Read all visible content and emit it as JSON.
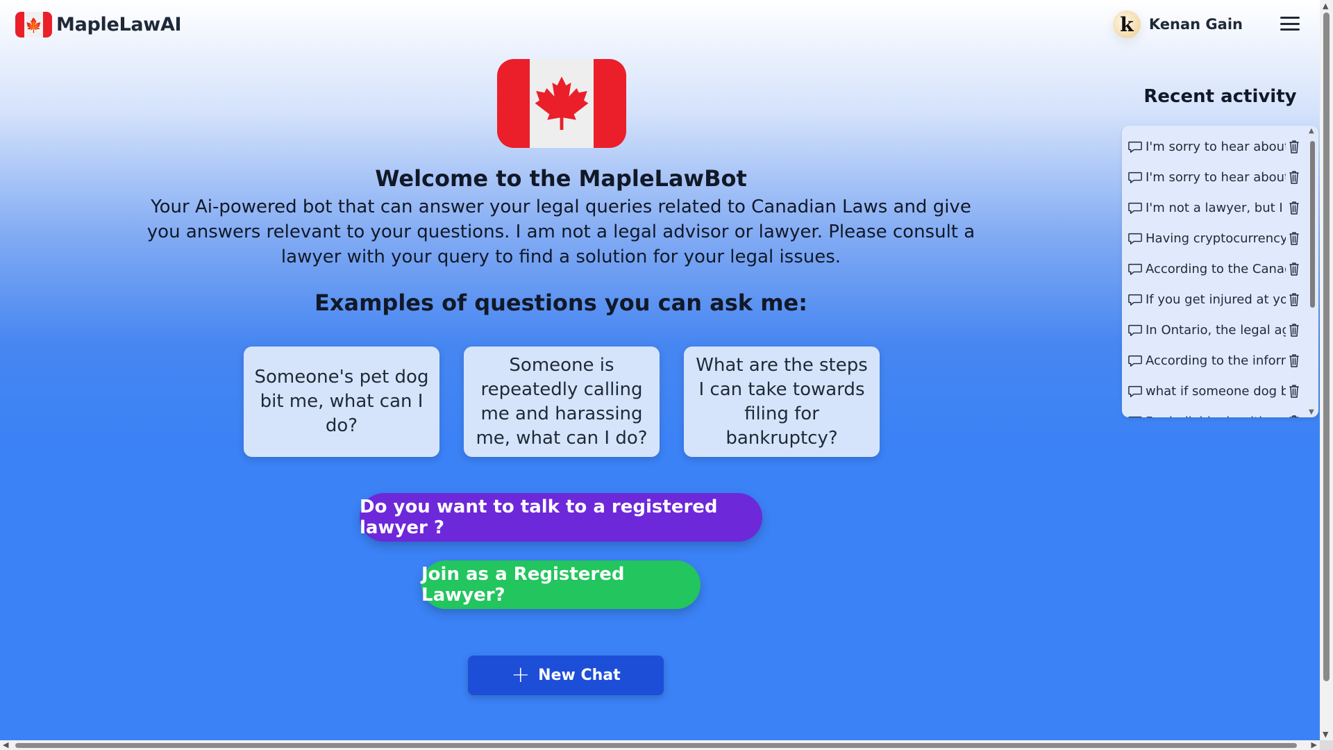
{
  "brand": {
    "name": "MapleLawAI",
    "flag_glyph": "🍁"
  },
  "user": {
    "name": "Kenan Gain",
    "avatar_letter": "k"
  },
  "welcome": {
    "title": "Welcome to the MapleLawBot",
    "intro": "Your Ai-powered bot that can answer your legal queries related to Canadian Laws and give you answers relevant to your questions. I am not a legal advisor or lawyer. Please consult a lawyer with your query to find a solution for your legal issues."
  },
  "examples": {
    "title": "Examples of questions you can ask me:",
    "items": [
      "Someone's pet dog bit me, what can I do?",
      "Someone is repeatedly calling me and harassing me, what can I do?",
      "What are the steps I can take towards filing for bankruptcy?"
    ]
  },
  "actions": {
    "talk_label": "Do you want to talk to a registered lawyer ?",
    "join_label": "Join as a Registered Lawyer?",
    "new_chat_label": "New Chat"
  },
  "recent": {
    "title": "Recent activity",
    "items": [
      "I'm sorry to hear about y",
      "I'm sorry to hear about y",
      "I'm not a lawyer, but I ca",
      "Having cryptocurrency i",
      "According to the Canadi",
      "If you get injured at your",
      "In Ontario, the legal age",
      "According to the informa",
      "what if someone dog bit",
      "For individuals with a ne"
    ]
  },
  "colors": {
    "talk_button": "#6d28d9",
    "join_button": "#22c55e",
    "new_chat_button": "#1d4ed8",
    "flag_red": "#ea1f2a",
    "background_blue": "#3b82f6"
  },
  "icons": [
    "maple-leaf-icon",
    "menu-icon",
    "chat-bubble-icon",
    "trash-icon",
    "plus-icon"
  ]
}
